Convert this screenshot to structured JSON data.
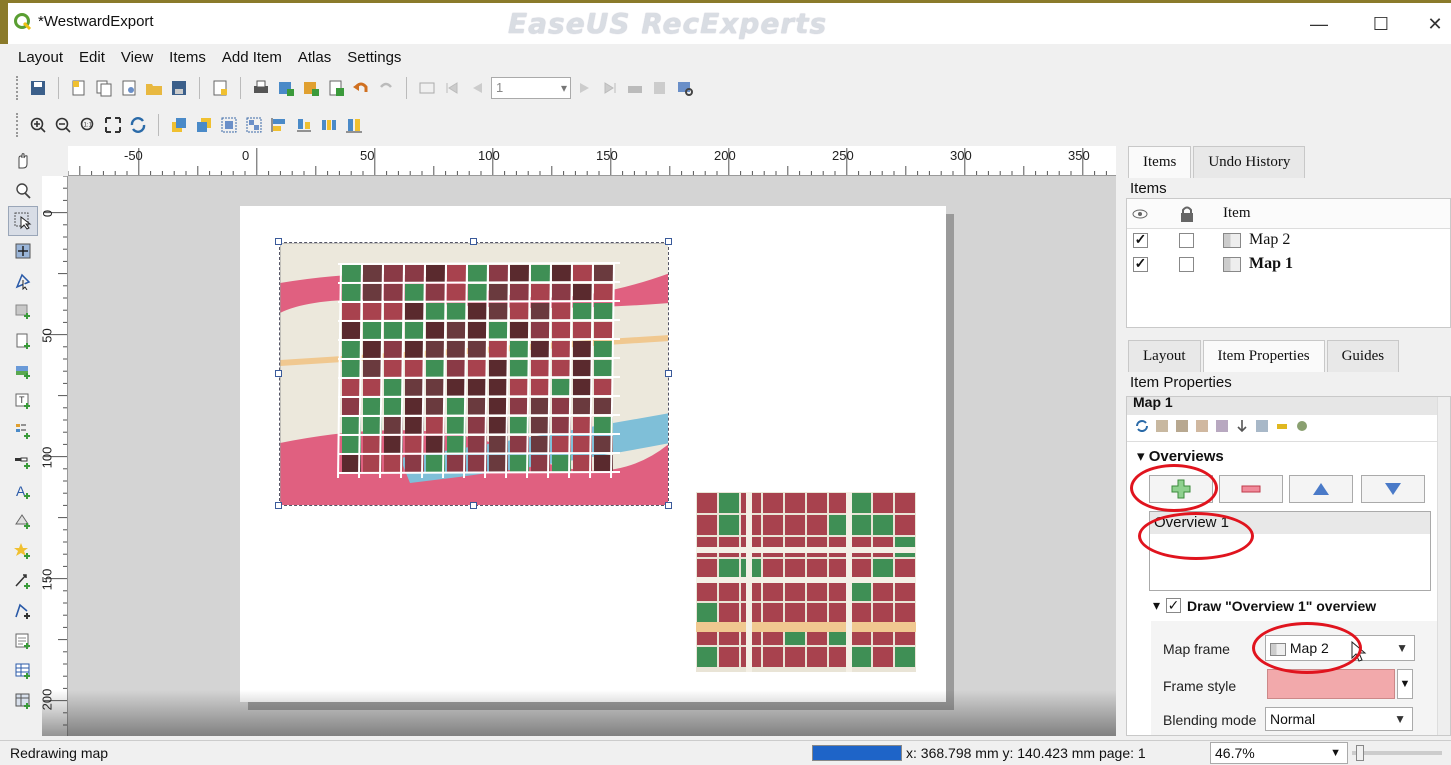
{
  "window": {
    "title": "*WestwardExport",
    "watermark": "EaseUS RecExperts",
    "minimize": "—",
    "maximize": "☐",
    "close": "✕"
  },
  "menu": [
    "Layout",
    "Edit",
    "View",
    "Items",
    "Add Item",
    "Atlas",
    "Settings"
  ],
  "toolbar": {
    "page_number": "1"
  },
  "ruler": {
    "h_labels": [
      "-50",
      "0",
      "50",
      "100",
      "150",
      "200",
      "250",
      "300",
      "350"
    ],
    "v_labels": [
      "0",
      "50",
      "100",
      "150",
      "200"
    ]
  },
  "items_panel": {
    "tabs": [
      "Items",
      "Undo History"
    ],
    "active_tab": "Items",
    "heading": "Items",
    "column_item": "Item",
    "rows": [
      {
        "name": "Map 2",
        "visible": true,
        "locked": false,
        "bold": false
      },
      {
        "name": "Map 1",
        "visible": true,
        "locked": false,
        "bold": true
      }
    ]
  },
  "properties_panel": {
    "tabs": [
      "Layout",
      "Item Properties",
      "Guides"
    ],
    "active_tab": "Item Properties",
    "heading": "Item Properties",
    "item_name": "Map 1",
    "section": "Overviews",
    "overview_list": [
      "Overview 1"
    ],
    "draw_label": "Draw \"Overview 1\" overview",
    "map_frame_label": "Map frame",
    "map_frame_value": "Map 2",
    "frame_style_label": "Frame style",
    "frame_style_color": "#f2a9ab",
    "blending_label": "Blending mode",
    "blending_value": "Normal"
  },
  "status": {
    "message": "Redrawing map",
    "coords": "x: 368.798 mm y: 140.423 mm page: 1",
    "zoom": "46.7%"
  },
  "colors": {
    "accent_red": "#e0141e",
    "progress_blue": "#1e64c8",
    "parcel_red": "#a8424e",
    "parcel_green": "#3f8f55",
    "street_pink": "#e06080"
  }
}
